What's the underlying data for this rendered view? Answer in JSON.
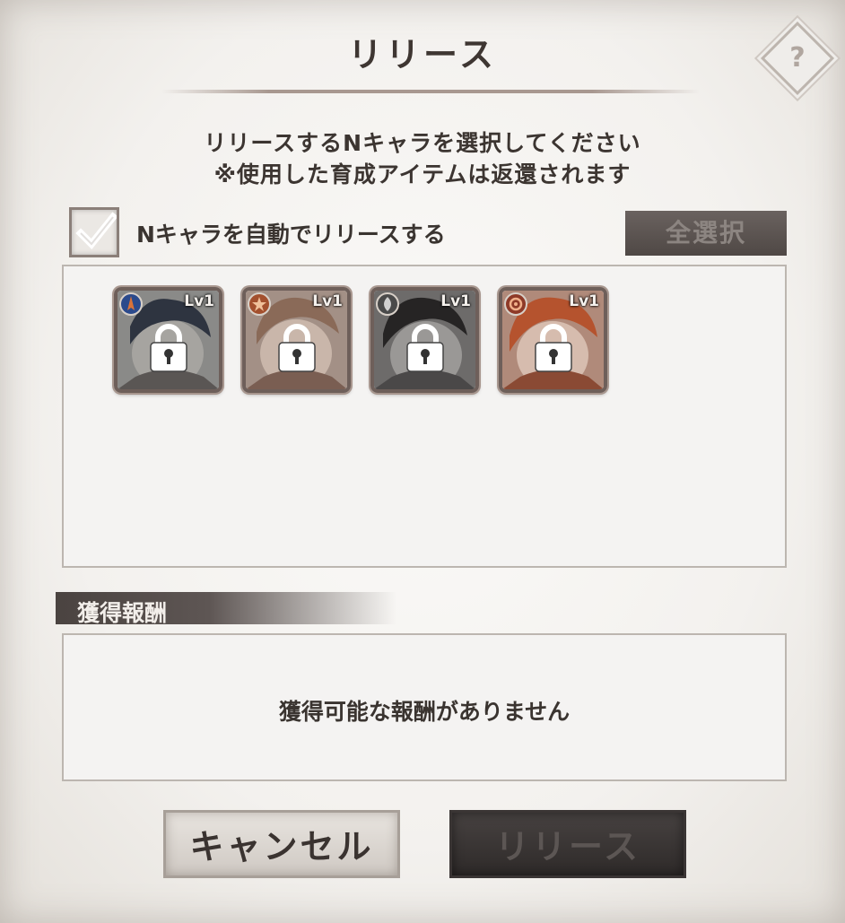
{
  "dialog": {
    "title": "リリース",
    "help_icon": "question-diamond-icon"
  },
  "instructions": {
    "line1": "リリースするNキャラを選択してください",
    "line2": "※使用した育成アイテムは返還されます"
  },
  "auto_release": {
    "checked": true,
    "label": "Nキャラを自動でリリースする"
  },
  "select_all_label": "全選択",
  "characters": [
    {
      "level": "Lv1",
      "element_icon": "blue-spear-element-icon",
      "locked": true,
      "art": "dark-blue-hair",
      "colors": {
        "bg": "#8a8a88",
        "frame": "#6b5a55"
      }
    },
    {
      "level": "Lv1",
      "element_icon": "orange-star-element-icon",
      "locked": true,
      "art": "light-brown-hair",
      "colors": {
        "bg": "#a39086",
        "frame": "#6b5a55"
      }
    },
    {
      "level": "Lv1",
      "element_icon": "gray-leaf-element-icon",
      "locked": true,
      "art": "black-hair",
      "colors": {
        "bg": "#6d6b6a",
        "frame": "#6b5a55"
      }
    },
    {
      "level": "Lv1",
      "element_icon": "red-swirl-element-icon",
      "locked": true,
      "art": "red-hair",
      "colors": {
        "bg": "#b08a7a",
        "frame": "#6b5a55"
      }
    }
  ],
  "rewards": {
    "header": "獲得報酬",
    "empty_message": "獲得可能な報酬がありません"
  },
  "buttons": {
    "cancel": "キャンセル",
    "release": "リリース"
  }
}
